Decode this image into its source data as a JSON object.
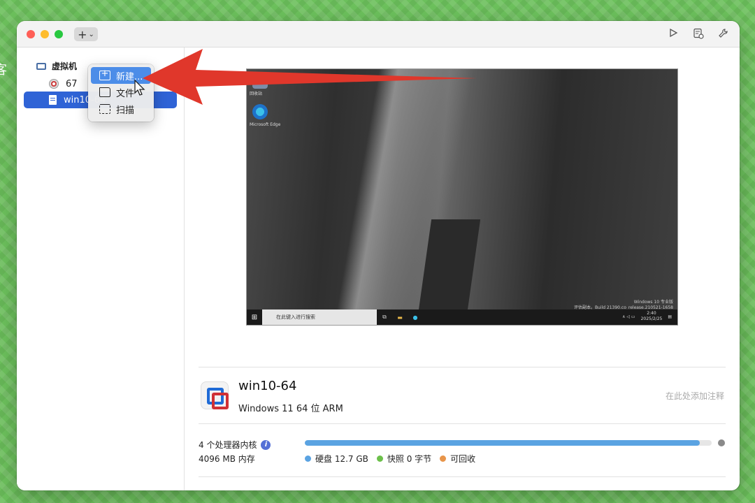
{
  "background_char": "客",
  "toolbar": {
    "add_label": "+",
    "add_chevron": "⌄"
  },
  "sidebar": {
    "group_label": "虚拟机",
    "items": [
      {
        "label": "67"
      },
      {
        "label": "win10-64"
      }
    ]
  },
  "menu": {
    "items": [
      {
        "label": "新建..."
      },
      {
        "label": "文件"
      },
      {
        "label": "扫描"
      }
    ]
  },
  "preview": {
    "desktop_icons": [
      "回收站",
      "Microsoft Edge"
    ],
    "search_placeholder": "在此键入进行搜索",
    "watermark_line1": "Windows 10 专业版",
    "watermark_line2": "评估副本。Build 21390.co_release.210521-1658",
    "clock_time": "2:40",
    "clock_date": "2025/2/25"
  },
  "vm": {
    "name": "win10-64",
    "os": "Windows 11 64 位 ARM",
    "note_placeholder": "在此处添加注释",
    "cpu": "4 个处理器内核",
    "memory": "4096 MB 内存",
    "disk_usage_fraction": 0.97,
    "legend": {
      "disk": "硬盘 12.7 GB",
      "snapshot": "快照 0 字节",
      "reclaimable": "可回收"
    }
  },
  "colors": {
    "accent": "#2f63d6",
    "disk": "#5aa3e2",
    "snapshot": "#6cc04a",
    "reclaimable": "#e8954a",
    "annotation_arrow": "#e0372b"
  }
}
